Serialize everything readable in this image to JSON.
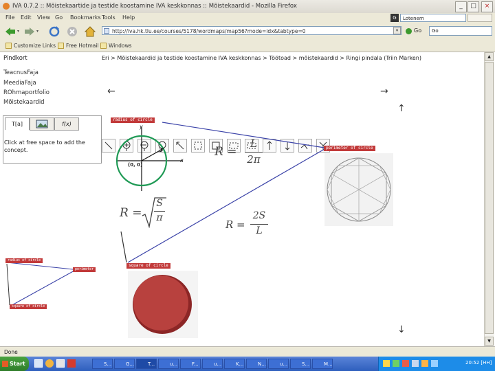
{
  "window": {
    "title": "IVA 0.7.2 :: Mõistekaartide ja testide koostamine IVA keskkonnas :: Mõistekaardid - Mozilla Firefox",
    "buttons": [
      "_",
      "□",
      "×"
    ]
  },
  "menu": [
    "File",
    "Edit",
    "View",
    "Go",
    "Bookmarks",
    "Tools",
    "Help"
  ],
  "toolbar": {
    "search_engine": "Lotenem",
    "url": "http://iva.hk.tlu.ee/courses/5178/wordmaps/map56?mode=idx&tabtype=0",
    "go_label": "Go",
    "go_field": "Go"
  },
  "bookmarks": [
    "Customize Links",
    "Free Hotmail",
    "Windows"
  ],
  "breadcrumb": "Eri > Mõistekaardid ja testide koostamine IVA keskkonnas > Töötoad > mõistekaardid > Ringi pindala (Triin Marken)",
  "sidebar": {
    "title": "Pindkort",
    "items": [
      "TeacnusFaja",
      "MeediaFaja",
      "ROhmaportfolio",
      "Mõistekaardid"
    ]
  },
  "tool_panel": {
    "tabs": [
      "T[a]",
      "img",
      "f(x)"
    ],
    "hint": "Click at free space to add the concept."
  },
  "map": {
    "concepts": {
      "radius": "radius of circle",
      "perimeter": "perimeter of circle",
      "square": "square of circle"
    },
    "axes": {
      "y": "y",
      "x": "x",
      "origin": "(0, 0)",
      "radius_label": "3"
    },
    "formulas": {
      "f1_lhs": "R =",
      "f1_num": "L",
      "f1_den": "2π",
      "f2_lhs": "R =",
      "f2_rad": "S",
      "f2_den": "π",
      "f3_lhs": "R =",
      "f3_num": "2S",
      "f3_den": "L"
    },
    "arrows": {
      "left": "←",
      "right": "→",
      "up": "↑",
      "down": "↓"
    }
  },
  "minimap": {
    "radius": "radius of circle",
    "perimeter": "perimeter",
    "square": "square of circle"
  },
  "status": "Done",
  "taskbar": {
    "start": "Start",
    "tasks": [
      "S...",
      "G...",
      "T...",
      "u...",
      "F...",
      "u...",
      "K...",
      "N...",
      "u...",
      "S...",
      "M..."
    ],
    "clock": "20:52 [HH]"
  }
}
